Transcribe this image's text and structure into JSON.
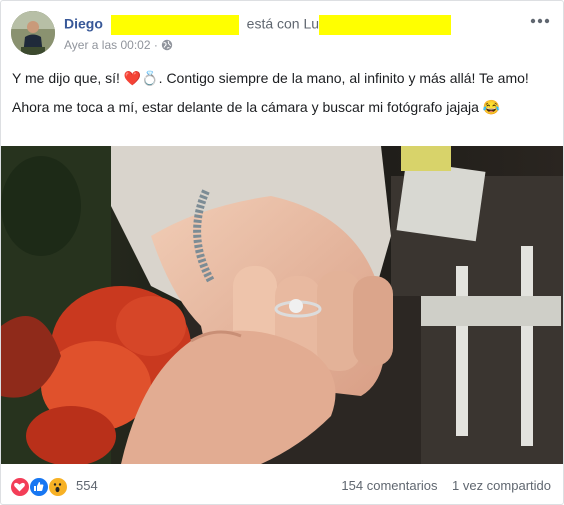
{
  "post": {
    "author_name": "Diego",
    "with_text": "está con Lu",
    "timestamp": "Ayer a las 00:02",
    "audience_icon": "globe-icon",
    "menu_icon": "more-options-icon",
    "paragraph_1": "Y me dijo que, sí! ❤️💍. Contigo siempre de la mano, al infinito y más allá! Te amo!",
    "paragraph_2": "Ahora me toca a mí, estar delante de la cámara y buscar mi fotógrafo jajaja 😂"
  },
  "footer": {
    "reaction_icons": [
      "love-reaction-icon",
      "like-reaction-icon",
      "wow-reaction-icon"
    ],
    "reaction_count": "554",
    "comments": "154 comentarios",
    "shares": "1 vez compartido"
  },
  "colors": {
    "link": "#385898",
    "secondary": "#606770",
    "redaction": "#ffff00",
    "love": "#f33e58",
    "like": "#1877f2",
    "wow": "#f7b125"
  }
}
